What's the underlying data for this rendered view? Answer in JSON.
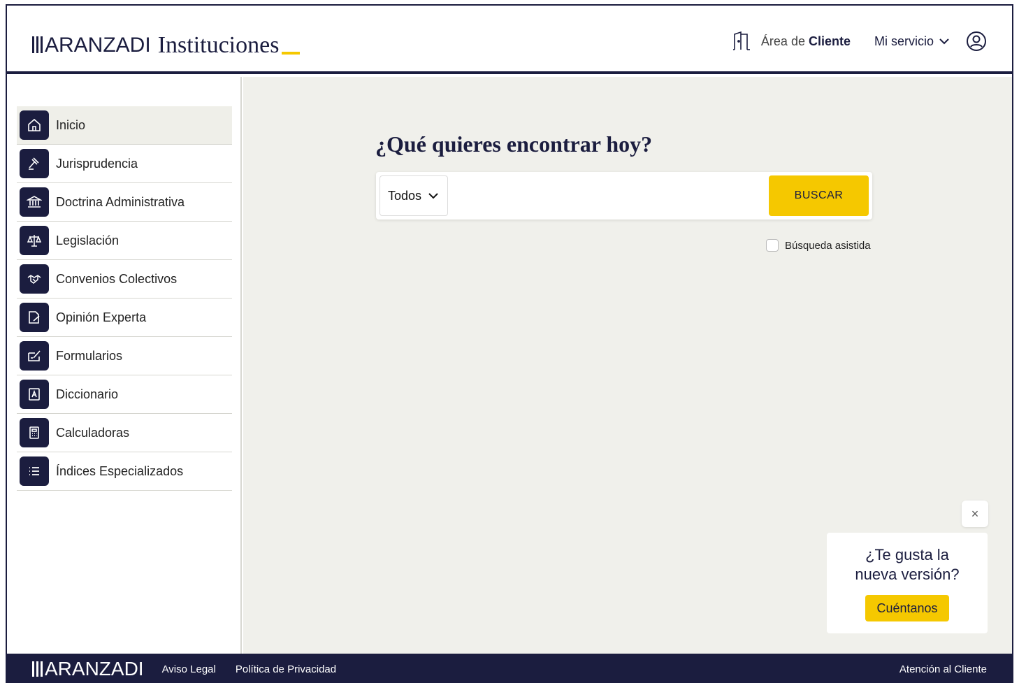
{
  "header": {
    "logo_brand": "ARANZADI",
    "logo_product": "Instituciones",
    "area_prefix": "Área de ",
    "area_strong": "Cliente",
    "mi_servicio": "Mi servicio"
  },
  "sidebar": {
    "items": [
      {
        "label": "Inicio",
        "icon": "home-icon",
        "active": true
      },
      {
        "label": "Jurisprudencia",
        "icon": "gavel-icon"
      },
      {
        "label": "Doctrina Administrativa",
        "icon": "bank-icon"
      },
      {
        "label": "Legislación",
        "icon": "scales-icon"
      },
      {
        "label": "Convenios Colectivos",
        "icon": "handshake-icon"
      },
      {
        "label": "Opinión Experta",
        "icon": "document-pen-icon"
      },
      {
        "label": "Formularios",
        "icon": "form-pen-icon"
      },
      {
        "label": "Diccionario",
        "icon": "dictionary-icon"
      },
      {
        "label": "Calculadoras",
        "icon": "calculator-icon"
      },
      {
        "label": "Índices Especializados",
        "icon": "list-icon"
      }
    ]
  },
  "main": {
    "title": "¿Qué quieres encontrar hoy?",
    "search": {
      "select_value": "Todos",
      "input_value": "",
      "placeholder": "",
      "button_label": "BUSCAR"
    },
    "assisted_label": "Búsqueda asistida"
  },
  "feedback": {
    "close_label": "×",
    "text_line1": "¿Te gusta la",
    "text_line2": "nueva versión?",
    "button_label": "Cuéntanos"
  },
  "footer": {
    "logo_brand": "ARANZADI",
    "links": [
      "Aviso Legal",
      "Política de Privacidad"
    ],
    "right_link": "Atención al Cliente"
  },
  "colors": {
    "navy": "#1b1d3f",
    "yellow": "#f5c800",
    "main_bg": "#f0f0eb"
  }
}
